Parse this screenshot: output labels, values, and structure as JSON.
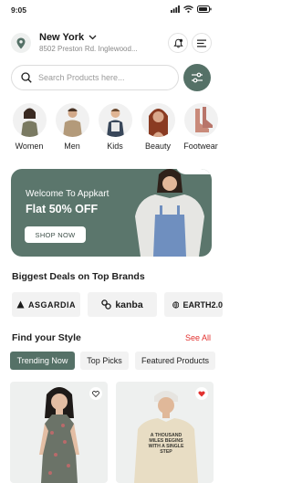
{
  "status_bar": {
    "time": "9:05"
  },
  "location": {
    "city": "New York",
    "address": "8502 Preston Rd. Inglewood..."
  },
  "search": {
    "placeholder": "Search Products here..."
  },
  "categories": [
    {
      "label": "Women"
    },
    {
      "label": "Men"
    },
    {
      "label": "Kids"
    },
    {
      "label": "Beauty"
    },
    {
      "label": "Footwear"
    }
  ],
  "banner": {
    "subtitle": "Welcome To Appkart",
    "title": "Flat 50% OFF",
    "button": "SHOP NOW"
  },
  "brands_section": {
    "title": "Biggest Deals on Top Brands"
  },
  "brands": [
    {
      "name": "ASGARDIA"
    },
    {
      "name": "kanba"
    },
    {
      "name": "EARTH2.0"
    }
  ],
  "style_section": {
    "title": "Find your Style",
    "see_all": "See All"
  },
  "filter_tabs": [
    {
      "label": "Trending Now",
      "active": true
    },
    {
      "label": "Top Picks",
      "active": false
    },
    {
      "label": "Featured Products",
      "active": false
    }
  ],
  "products": [
    {
      "favorite": false
    },
    {
      "favorite": true,
      "print_lines": [
        "A THOUSAND",
        "MILES BEGINS",
        "WITH A SINGLE",
        "STEP"
      ]
    }
  ],
  "colors": {
    "accent": "#557167",
    "highlight": "#e2312f"
  }
}
